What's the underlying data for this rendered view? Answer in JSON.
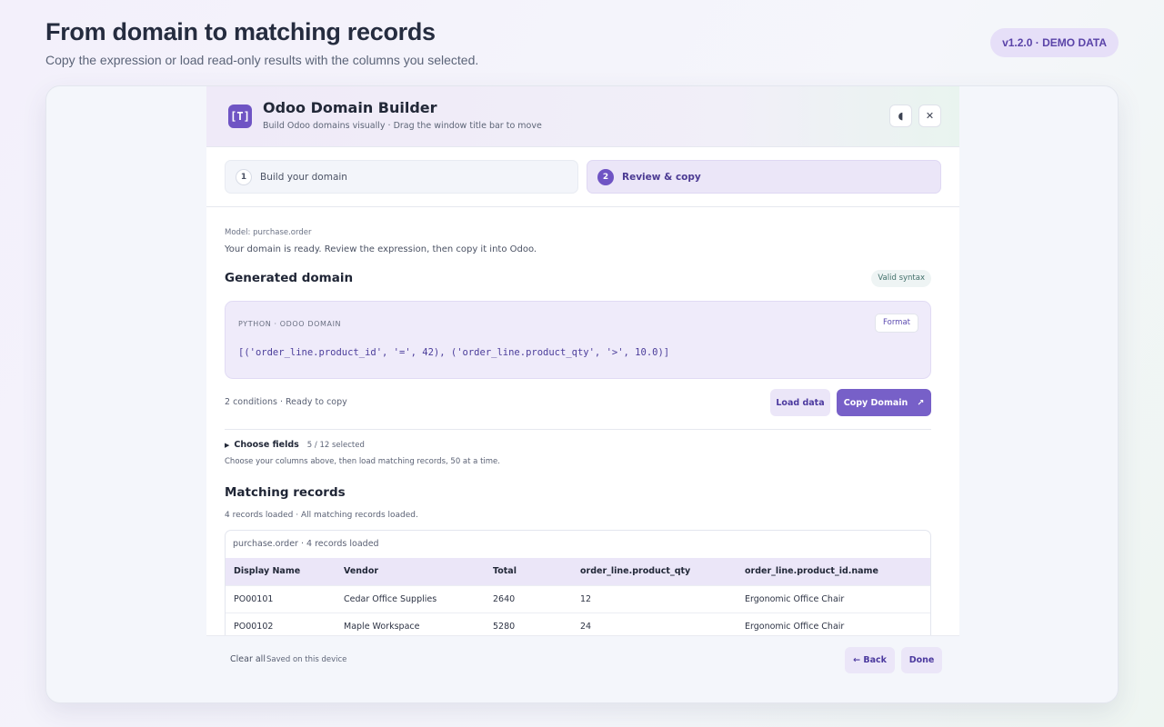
{
  "page": {
    "title": "From domain to matching records",
    "subtitle": "Copy the expression or load read-only results with the columns you selected.",
    "version_badge": "v1.2.0 · DEMO DATA"
  },
  "app": {
    "logo_glyph": "[T]",
    "title": "Odoo Domain Builder",
    "subtitle": "Build Odoo domains visually · Drag the window title bar to move",
    "theme_toggle_glyph": "◖",
    "close_glyph": "✕"
  },
  "steps": [
    {
      "number": "1",
      "label": "Build your domain",
      "active": false
    },
    {
      "number": "2",
      "label": "Review & copy",
      "active": true
    }
  ],
  "review": {
    "model_label": "Model: purchase.order",
    "ready_text": "Your domain is ready. Review the expression, then copy it into Odoo.",
    "generated_title": "Generated domain",
    "valid_badge": "Valid syntax",
    "code_lang": "PYTHON · ODOO DOMAIN",
    "format_label": "Format",
    "domain_expression": "[('order_line.product_id', '=', 42), ('order_line.product_qty', '>', 10.0)]",
    "conditions_status": "2 conditions · Ready to copy",
    "load_data_label": "Load data",
    "copy_domain_label": "Copy Domain",
    "copy_icon_glyph": "↗"
  },
  "fields": {
    "caret_glyph": "▶",
    "toggle_label": "Choose fields",
    "count": "5 / 12 selected",
    "hint": "Choose your columns above, then load matching records, 50 at a time."
  },
  "records": {
    "title": "Matching records",
    "status": "4 records loaded · All matching records loaded.",
    "table_caption": "purchase.order · 4 records loaded",
    "columns": [
      "Display Name",
      "Vendor",
      "Total",
      "order_line.product_qty",
      "order_line.product_id.name"
    ],
    "rows": [
      [
        "PO00101",
        "Cedar Office Supplies",
        "2640",
        "12",
        "Ergonomic Office Chair"
      ],
      [
        "PO00102",
        "Maple Workspace",
        "5280",
        "24",
        "Ergonomic Office Chair"
      ]
    ]
  },
  "footer": {
    "clear_label": "Clear all",
    "saved_text": "Saved on this device",
    "back_label": "← Back",
    "done_label": "Done"
  },
  "colors": {
    "accent": "#7760c8",
    "accent_soft": "#ebe6f8",
    "text_primary": "#1f2433"
  }
}
